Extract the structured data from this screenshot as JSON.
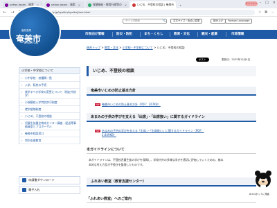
{
  "browser": {
    "tabs": [
      {
        "label": "yahoo japan - 検索"
      },
      {
        "label": "yahoo japan - 検索"
      },
      {
        "label": "保健福祉・教育行政等の"
      },
      {
        "label": "いじめ、不登校の相談 | 奄美市"
      }
    ],
    "profile_label": "サインイン",
    "url": "www.city.amami.lg.jp/kyoiiku/kyoiku/jime.html"
  },
  "header": {
    "logo_prefecture": "鹿児島県",
    "logo_city": "奄美市",
    "logo_romaji": "Amami City",
    "search_placeholder": "サイト内検索",
    "search_button": "🔍",
    "btn_text_size": "文字サイズ・色合い変更",
    "btn_reader": "読み上げ",
    "btn_language": "Foreign Language"
  },
  "nav": {
    "items": [
      "市民向け情報",
      "防災・防犯",
      "まち・くらし",
      "教育・文化",
      "観光・産業",
      "市政情報"
    ]
  },
  "breadcrumb": {
    "items": [
      "総合トップ",
      "教育・文化",
      "小学校・中学校について",
      "いじめ、不登校の相談"
    ],
    "sep": " > "
  },
  "sidebar": {
    "heading": "小学校・中学校について",
    "items": [
      "小中学校・校種属一覧",
      "入学、転校の手続",
      "就学すべき学校の変更について（指定外就学）",
      "小規模校入学特別許可制度",
      "就学援助制度",
      "いじめ、不登校の相談",
      "児童生徒健全育成センター講座・配送等事務員室とプロボーザル",
      "奄美市相談窓口",
      "特別支援教育"
    ],
    "btn_application": "申請書ダウンロード",
    "btn_e_application": "電子入札"
  },
  "main": {
    "page_title": "いじめ、不登校の相談",
    "post_label": "ポスト",
    "updated": "更新日：2025年12月4日",
    "section1_title": "奄美市いじめの防止基本方針",
    "section1_link": "奄美市いじめの防止基本方針（PDF：267KB）",
    "section2_title": "あまみの子供の学びを支える「出席」・「出席扱い」に関するガイドライン",
    "section2_link_line1": "あまみの子供の学びを支える「出席」・「出席扱い」に関するガイドライン（PDF：",
    "section2_link_line2": "2,849KB）",
    "pdf_badge": "PDF",
    "section3_title": "本ガイドラインについて",
    "section3_body1": "本ガイドラインは、不登校児童生徒の学びを保障し、学校内外の多様な学びを適切に評価していくための、基本",
    "section3_body2": "本的な考え方及び手続きを整理したものです。",
    "section4_title": "ふれあい教室（教育支援センター）",
    "section5_title": "「ふれあい教室」へのご案内"
  },
  "mascot": {
    "label": "AI×ロボットに相談"
  },
  "colors": {
    "primary": "#1f5aa6",
    "pdf_red": "#c8102e"
  }
}
